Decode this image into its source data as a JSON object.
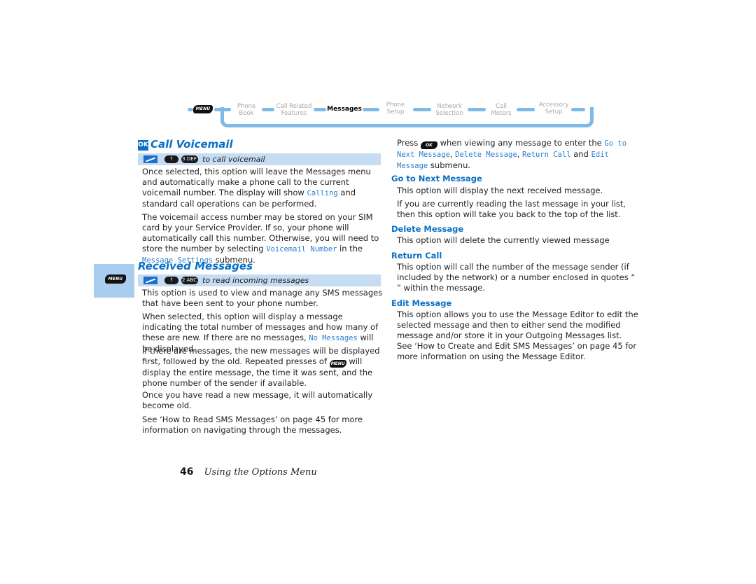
{
  "nav": {
    "menu_key": "MENU",
    "items": [
      {
        "label": "Phone\nBook",
        "active": false
      },
      {
        "label": "Call Related\nFeatures",
        "active": false
      },
      {
        "label": "Messages",
        "active": true
      },
      {
        "label": "Phone\nSetup",
        "active": false
      },
      {
        "label": "Network\nSelection",
        "active": false
      },
      {
        "label": "Call\nMeters",
        "active": false
      },
      {
        "label": "Accessory\nSetup",
        "active": false
      }
    ]
  },
  "call_voicemail": {
    "badge": "OK",
    "title": "Call Voicemail",
    "shortcut": {
      "key1": "↑",
      "key2": "3 DEF",
      "text": "to call voicemail"
    },
    "p1": {
      "a": "Once selected, this option will leave the Messages menu and automatically make a phone call to the current voicemail number. The display will show ",
      "code": "Calling",
      "b": " and standard call operations can be performed."
    },
    "p2": {
      "a": "The voicemail access number may be stored on your SIM card by your Service Provider. If so, your phone will automatically call this number. Otherwise, you will need to store the number by selecting ",
      "code1": "Voicemail Number",
      "b": " in the ",
      "code2": "Message Settings",
      "c": " submenu."
    }
  },
  "received_messages": {
    "side_key": "MENU",
    "title": "Received Messages",
    "shortcut": {
      "key1": "↑",
      "key2": "2 ABC",
      "text": "to read incoming messages"
    },
    "p1": "This option is used to view and manage any SMS messages that have been sent to your phone number.",
    "p2": {
      "a": "When selected, this option will display a message indicating the total number of messages and how many of these are new. If there are no messages, ",
      "code": "No Messages",
      "b": " will be displayed."
    },
    "p3": {
      "a": "If there are messages, the new messages will be displayed first, followed by the old. Repeated presses of ",
      "key": "MENU",
      "b": " will display the entire message, the time it was sent, and the phone number of the sender if available."
    },
    "p4": "Once you have read a new message, it will automatically become old.",
    "p5": "See ‘How to Read SMS Messages’ on page 45 for more information on navigating through the messages."
  },
  "right": {
    "intro": {
      "a": "Press ",
      "key": "OK",
      "b": " when viewing any message to enter the ",
      "code1": "Go to Next Message",
      "sep1": ", ",
      "code2": "Delete Message",
      "sep2": ", ",
      "code3": "Return Call",
      "and": " and ",
      "code4": "Edit Message",
      "c": " submenu."
    },
    "sections": [
      {
        "title": "Go to Next Message",
        "paras": [
          "This option will display the next received message.",
          "If you are currently reading the last message in your list, then this option will take you back to the top of the list."
        ]
      },
      {
        "title": "Delete Message",
        "paras": [
          "This option will delete the currently viewed message"
        ]
      },
      {
        "title": "Return Call",
        "paras": [
          "This option will call the number of the message sender (if included by the network) or a number enclosed in quotes “ ” within the message."
        ]
      },
      {
        "title": "Edit Message",
        "paras": [
          "This option allows you to use the Message Editor to edit the selected message and then to either send the modified message and/or store it in your Outgoing Messages list. See ‘How to Create and Edit SMS Messages’ on page 45 for more information on using the Message Editor."
        ]
      }
    ]
  },
  "footer": {
    "page_number": "46",
    "section": "Using the Options Menu"
  }
}
